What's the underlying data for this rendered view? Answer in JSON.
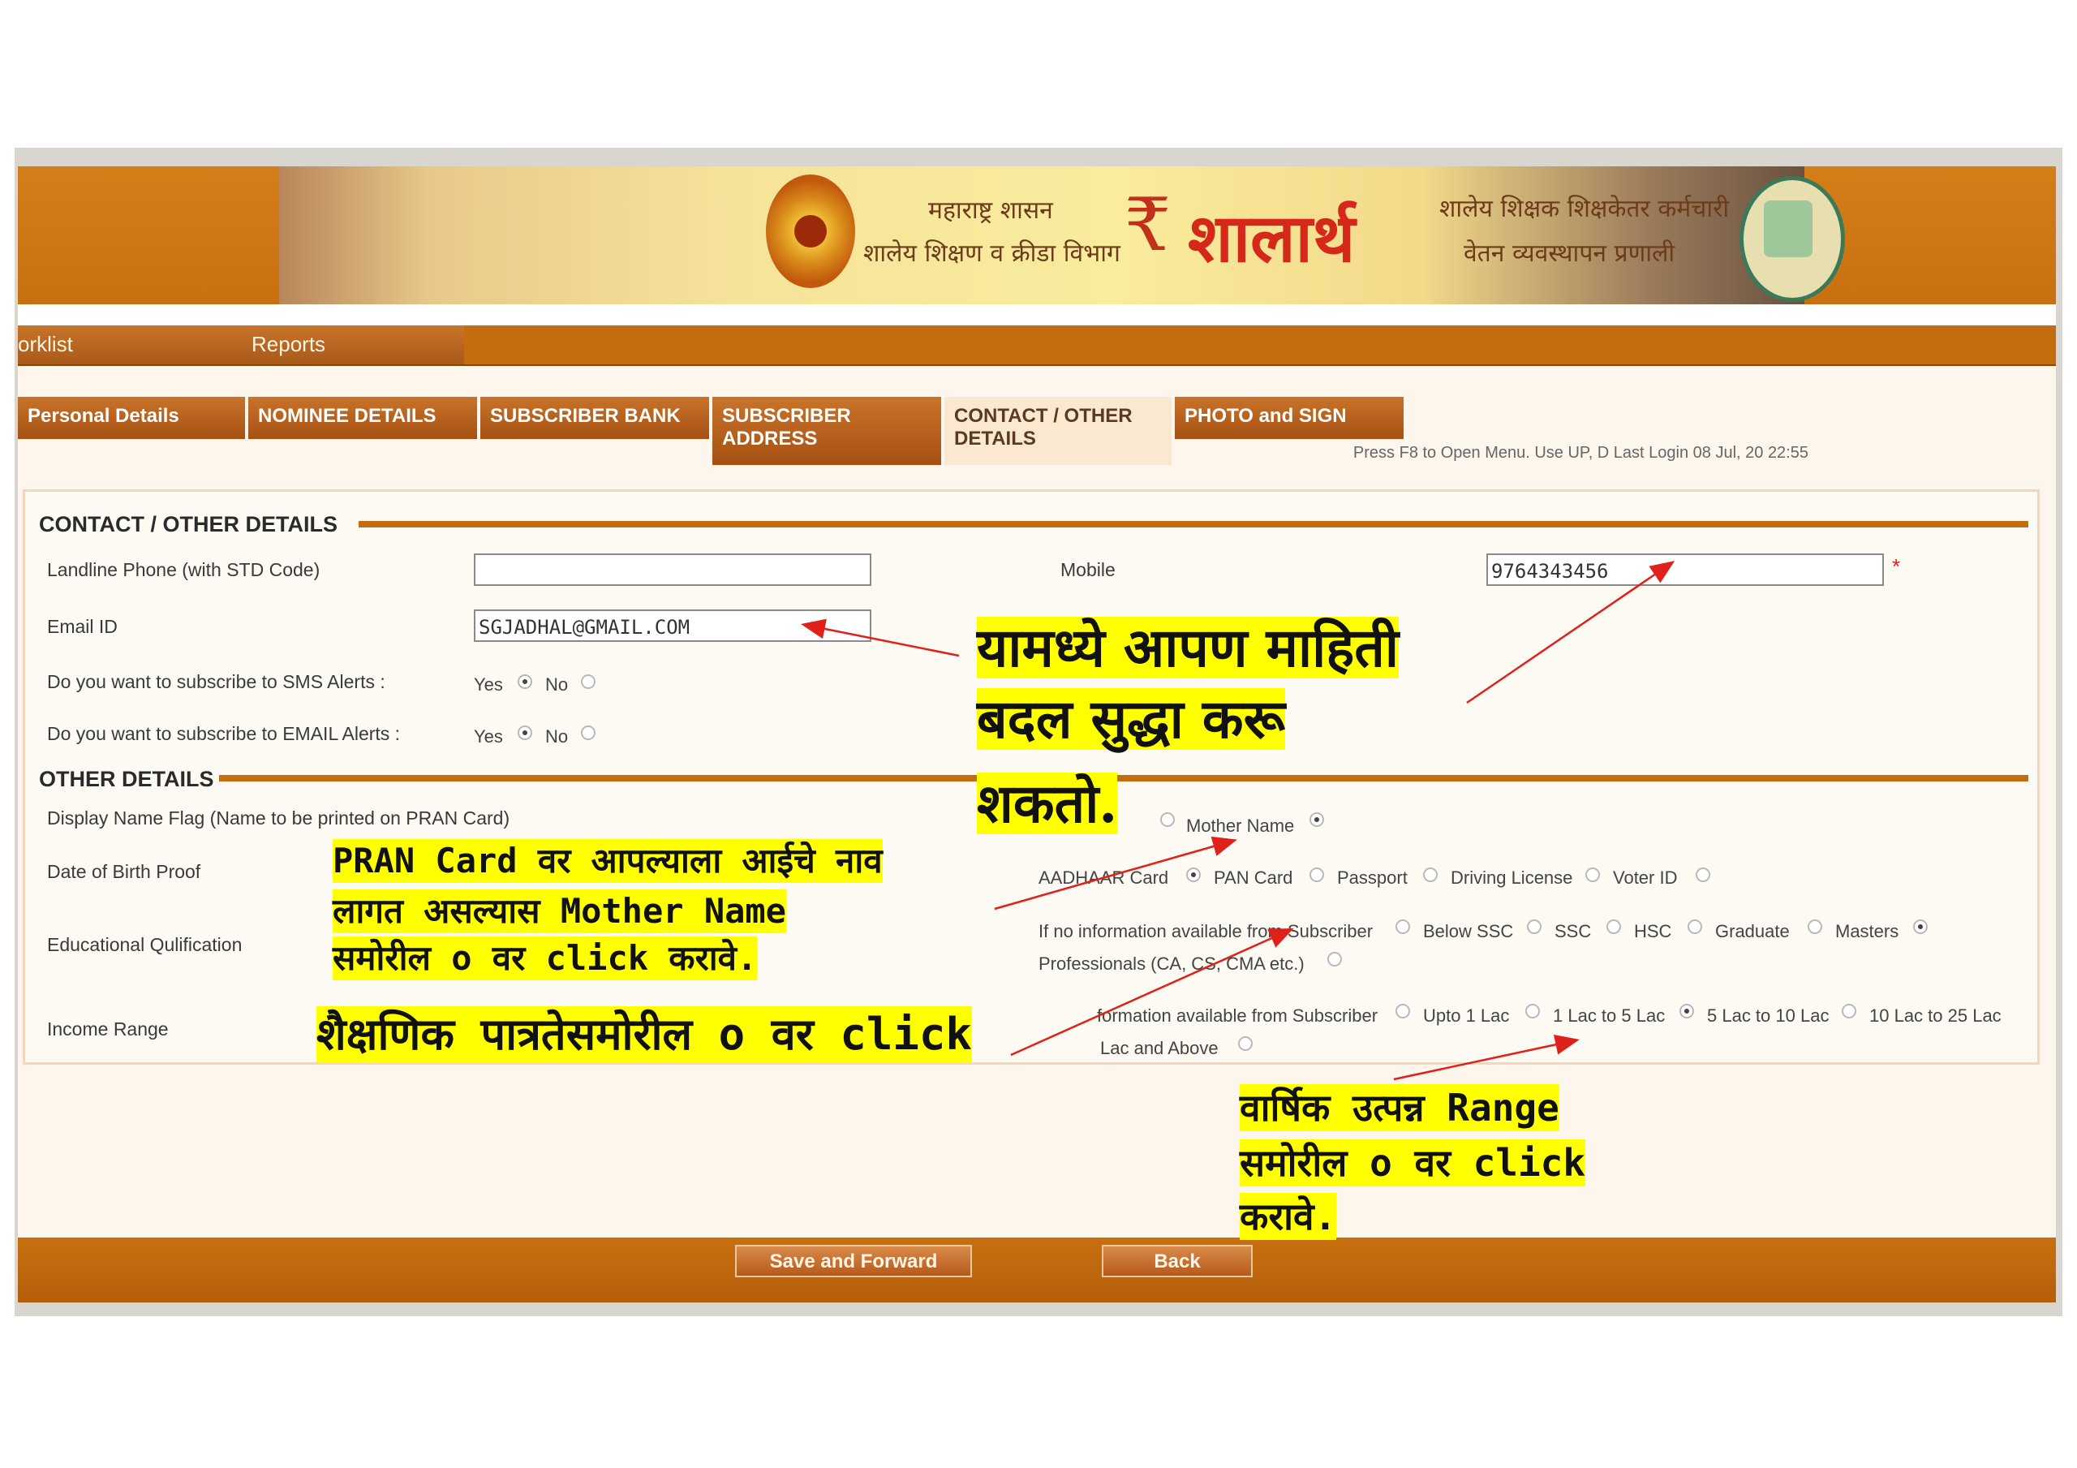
{
  "banner": {
    "line1": "महाराष्ट्र शासन",
    "line2": "शालेय शिक्षण व क्रीडा विभाग",
    "logo": "शालार्थ",
    "line3": "शालेय शिक्षक शिक्षकेतर कर्मचारी",
    "line4": "वेतन व्यवस्थापन प्रणाली",
    "hint": "Press F8 to Open Menu. Use UP, D Last Login 08 Jul, 20 22:55"
  },
  "menu": [
    "orklist",
    "Reports"
  ],
  "tabs": [
    {
      "label": "Personal Details"
    },
    {
      "label": "NOMINEE DETAILS"
    },
    {
      "label": "SUBSCRIBER BANK"
    },
    {
      "label": "SUBSCRIBER ADDRESS"
    },
    {
      "label": "CONTACT / OTHER DETAILS"
    },
    {
      "label": "PHOTO and SIGN"
    }
  ],
  "contact": {
    "title": "CONTACT / OTHER DETAILS",
    "landline_label": "Landline Phone (with STD Code)",
    "landline_value": "",
    "mobile_label": "Mobile",
    "mobile_value": "9764343456",
    "required": "*",
    "email_label": "Email ID",
    "email_value": "SGJADHAL@GMAIL.COM",
    "sms_label": "Do you want to subscribe to SMS Alerts :",
    "email_alert_label": "Do you want to subscribe to EMAIL Alerts :",
    "yes": "Yes",
    "no": "No"
  },
  "other": {
    "title": "OTHER DETAILS",
    "display_flag_label": "Display Name Flag (Name to be printed on PRAN Card)",
    "mother_name": "Mother Name",
    "dob_label": "Date of Birth Proof",
    "dob_options": [
      "AADHAAR Card",
      "PAN Card",
      "Passport",
      "Driving License",
      "Voter ID"
    ],
    "edu_label": "Educational Qulification",
    "edu_options": [
      "If no information available from Subscriber",
      "Below SSC",
      "SSC",
      "HSC",
      "Graduate",
      "Masters"
    ],
    "edu_options2": "Professionals (CA, CS, CMA etc.)",
    "income_label": "Income Range",
    "income_options": [
      "formation available from Subscriber",
      "Upto 1 Lac",
      "1 Lac to 5 Lac",
      "5 Lac to 10 Lac",
      "10 Lac to 25 Lac"
    ],
    "income_options2": "Lac and Above"
  },
  "buttons": {
    "save": "Save and Forward",
    "back": "Back"
  },
  "annotations": {
    "a1_l1": "यामध्ये आपण माहिती",
    "a1_l2": "बदल सुद्धा करू",
    "a1_l3": "शकतो.",
    "a2_l1": "PRAN Card वर आपल्याला आईचे नाव",
    "a2_l2": "लागत असल्यास Mother Name",
    "a2_l3": "समोरील o वर click करावे.",
    "a3": "शैक्षणिक पात्रतेसमोरील o वर click",
    "a4_l1": "वार्षिक उत्पन्न Range",
    "a4_l2": "समोरील o वर click",
    "a4_l3": "करावे."
  },
  "colors": {
    "accent": "#c46d10",
    "highlight": "#ffff00",
    "arrow": "#e0201a"
  }
}
